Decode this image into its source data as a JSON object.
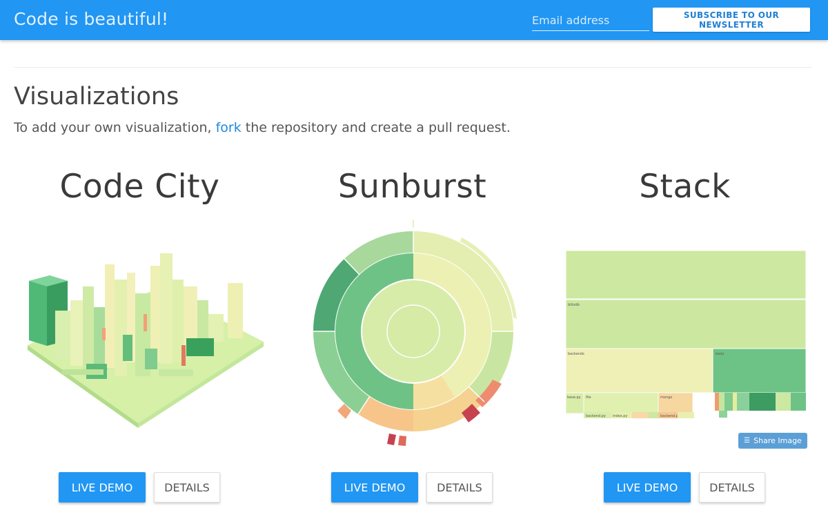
{
  "header": {
    "brand": "Code is beautiful!",
    "email_placeholder": "Email address",
    "subscribe_label": "SUBSCRIBE TO OUR NEWSLETTER"
  },
  "section": {
    "title": "Visualizations",
    "intro_before": "To add your own visualization, ",
    "intro_link": "fork",
    "intro_after": " the repository and create a pull request."
  },
  "cards": [
    {
      "title": "Code City",
      "live_label": "LIVE DEMO",
      "details_label": "DETAILS"
    },
    {
      "title": "Sunburst",
      "live_label": "LIVE DEMO",
      "details_label": "DETAILS"
    },
    {
      "title": "Stack",
      "live_label": "LIVE DEMO",
      "details_label": "DETAILS"
    }
  ],
  "stack": {
    "labels": [
      "blitzdb",
      "backends",
      "tests",
      "base.py",
      "file",
      "mongo",
      "backend.py",
      "index.py",
      "backend.py"
    ],
    "share_label": "Share Image",
    "share_icon": "layers-icon"
  },
  "colors": {
    "header": "#2196f3",
    "button": "#2196f3",
    "link": "#1e88e5"
  }
}
